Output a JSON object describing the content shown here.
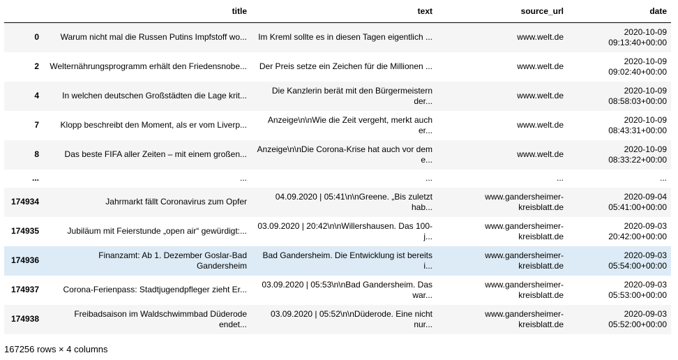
{
  "header": {
    "index": "",
    "title": "title",
    "text": "text",
    "source_url": "source_url",
    "date": "date"
  },
  "rows": [
    {
      "index": "0",
      "title": "Warum nicht mal die Russen Putins Impfstoff wo...",
      "text": "Im Kreml sollte es in diesen Tagen eigentlich ...",
      "source_url": "www.welt.de",
      "date": "2020-10-09 09:13:40+00:00"
    },
    {
      "index": "2",
      "title": "Welternährungsprogramm erhält den Friedensnobe...",
      "text": "Der Preis setze ein Zeichen für die Millionen ...",
      "source_url": "www.welt.de",
      "date": "2020-10-09 09:02:40+00:00"
    },
    {
      "index": "4",
      "title": "In welchen deutschen Großstädten die Lage krit...",
      "text": "Die Kanzlerin berät mit den Bürgermeistern der...",
      "source_url": "www.welt.de",
      "date": "2020-10-09 08:58:03+00:00"
    },
    {
      "index": "7",
      "title": "Klopp beschreibt den Moment, als er vom Liverp...",
      "text": "Anzeige\\n\\nWie die Zeit vergeht, merkt auch er...",
      "source_url": "www.welt.de",
      "date": "2020-10-09 08:43:31+00:00"
    },
    {
      "index": "8",
      "title": "Das beste FIFA aller Zeiten – mit einem großen...",
      "text": "Anzeige\\n\\nDie Corona-Krise hat auch vor dem e...",
      "source_url": "www.welt.de",
      "date": "2020-10-09 08:33:22+00:00"
    },
    {
      "index": "...",
      "title": "...",
      "text": "...",
      "source_url": "...",
      "date": "..."
    },
    {
      "index": "174934",
      "title": "Jahrmarkt fällt Coronavirus zum Opfer",
      "text": "04.09.2020 | 05:41\\n\\nGreene. „Bis zuletzt hab...",
      "source_url": "www.gandersheimer-kreisblatt.de",
      "date": "2020-09-04 05:41:00+00:00"
    },
    {
      "index": "174935",
      "title": "Jubiläum mit Feierstunde „open air“ gewürdigt:...",
      "text": "03.09.2020 | 20:42\\n\\nWillershausen. Das 100-j...",
      "source_url": "www.gandersheimer-kreisblatt.de",
      "date": "2020-09-03 20:42:00+00:00"
    },
    {
      "index": "174936",
      "title": "Finanzamt: Ab 1. Dezember Goslar-Bad Gandersheim",
      "text": "Bad Gandersheim. Die Entwicklung ist bereits i...",
      "source_url": "www.gandersheimer-kreisblatt.de",
      "date": "2020-09-03 05:54:00+00:00"
    },
    {
      "index": "174937",
      "title": "Corona-Ferienpass: Stadtjugendpfleger zieht Er...",
      "text": "03.09.2020 | 05:53\\n\\nBad Gandersheim. Das war...",
      "source_url": "www.gandersheimer-kreisblatt.de",
      "date": "2020-09-03 05:53:00+00:00"
    },
    {
      "index": "174938",
      "title": "Freibadsaison im Waldschwimmbad Düderode endet...",
      "text": "03.09.2020 | 05:52\\n\\nDüderode. Eine nicht nur...",
      "source_url": "www.gandersheimer-kreisblatt.de",
      "date": "2020-09-03 05:52:00+00:00"
    }
  ],
  "hovered_row": 8,
  "footer": "167256 rows × 4 columns"
}
